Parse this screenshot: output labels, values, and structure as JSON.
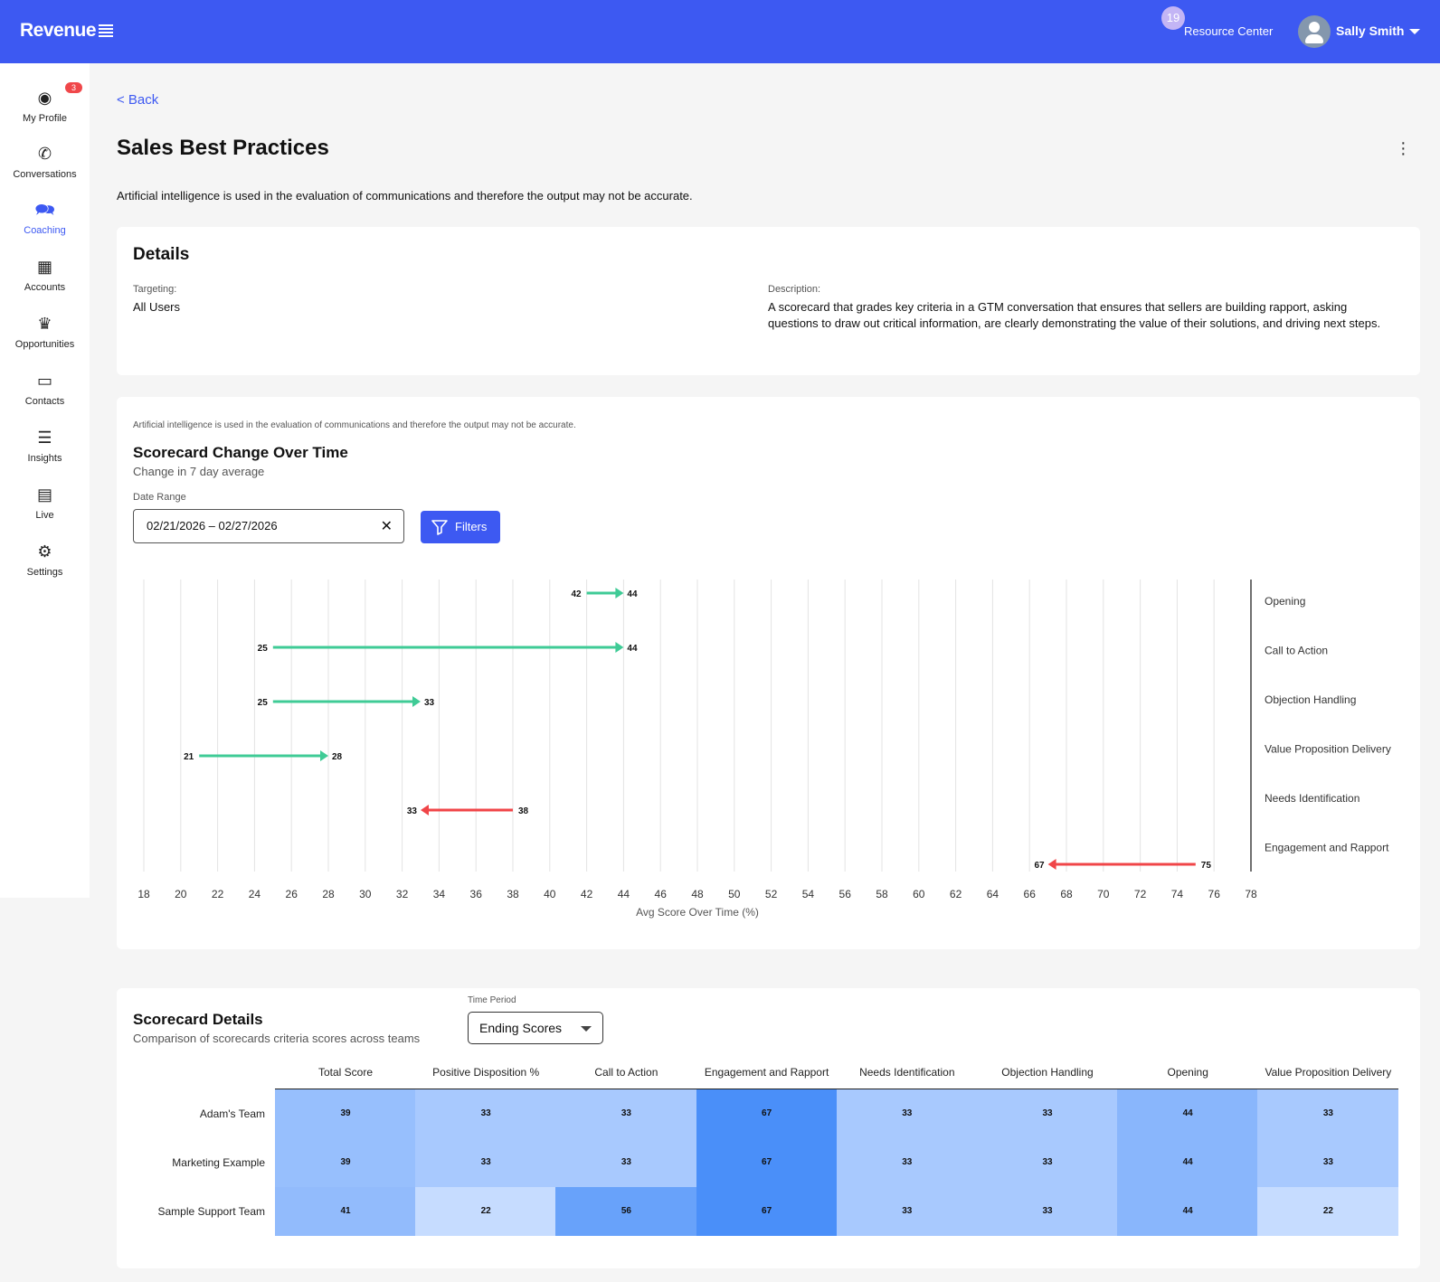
{
  "header": {
    "logo": "Revenue",
    "resource_badge": "19",
    "resource_center": "Resource Center",
    "user_name": "Sally Smith"
  },
  "sidebar": {
    "items": [
      {
        "label": "My Profile",
        "icon": "profile-icon",
        "badge": "3"
      },
      {
        "label": "Conversations",
        "icon": "phone-icon"
      },
      {
        "label": "Coaching",
        "icon": "chat-bubbles-icon",
        "active": true
      },
      {
        "label": "Accounts",
        "icon": "buildings-icon"
      },
      {
        "label": "Opportunities",
        "icon": "crown-icon"
      },
      {
        "label": "Contacts",
        "icon": "contact-card-icon"
      },
      {
        "label": "Insights",
        "icon": "bar-chart-icon"
      },
      {
        "label": "Live",
        "icon": "list-icon"
      },
      {
        "label": "Settings",
        "icon": "gear-icon"
      }
    ]
  },
  "page": {
    "back": "< Back",
    "title": "Sales Best Practices",
    "disclaimer": "Artificial intelligence is used in the evaluation of communications and therefore the output may not be accurate."
  },
  "details": {
    "title": "Details",
    "targeting_label": "Targeting:",
    "targeting_value": "All Users",
    "description_label": "Description:",
    "description_value": "A scorecard that grades key criteria in a GTM conversation that ensures that sellers are building rapport, asking questions to draw out critical information, are clearly demonstrating the value of their solutions, and driving next steps."
  },
  "change": {
    "disclaimer": "Artificial intelligence is used in the evaluation of communications and therefore the output may not be accurate.",
    "title": "Scorecard Change Over Time",
    "subtitle": "Change in 7 day average",
    "date_label": "Date Range",
    "date_value": "02/21/2026 – 02/27/2026",
    "filters": "Filters"
  },
  "chart_data": {
    "type": "range-arrow",
    "xlabel": "Avg Score Over Time (%)",
    "xlim": [
      18,
      78
    ],
    "xticks": [
      18,
      20,
      22,
      24,
      26,
      28,
      30,
      32,
      34,
      36,
      38,
      40,
      42,
      44,
      46,
      48,
      50,
      52,
      54,
      56,
      58,
      60,
      62,
      64,
      66,
      68,
      70,
      72,
      74,
      76,
      78
    ],
    "series": [
      {
        "name": "Opening",
        "start": 42,
        "end": 44
      },
      {
        "name": "Call to Action",
        "start": 25,
        "end": 44
      },
      {
        "name": "Objection Handling",
        "start": 25,
        "end": 33
      },
      {
        "name": "Value Proposition Delivery",
        "start": 21,
        "end": 28
      },
      {
        "name": "Needs Identification",
        "start": 38,
        "end": 33
      },
      {
        "name": "Engagement and Rapport",
        "start": 75,
        "end": 67
      }
    ],
    "colors": {
      "up": "#3fcb96",
      "down": "#f04548"
    }
  },
  "details_table": {
    "title": "Scorecard Details",
    "subtitle": "Comparison of scorecards criteria scores across teams",
    "period_label": "Time Period",
    "period_value": "Ending Scores",
    "columns": [
      "Total Score",
      "Positive Disposition %",
      "Call to Action",
      "Engagement and Rapport",
      "Needs Identification",
      "Objection Handling",
      "Opening",
      "Value Proposition Delivery"
    ],
    "rows": [
      {
        "team": "Adam's Team",
        "values": [
          "39",
          "33",
          "33",
          "67",
          "33",
          "33",
          "44",
          "33"
        ]
      },
      {
        "team": "Marketing Example",
        "values": [
          "39",
          "33",
          "33",
          "67",
          "33",
          "33",
          "44",
          "33"
        ]
      },
      {
        "team": "Sample Support Team",
        "values": [
          "41",
          "22",
          "56",
          "67",
          "33",
          "33",
          "44",
          "22"
        ]
      }
    ]
  }
}
